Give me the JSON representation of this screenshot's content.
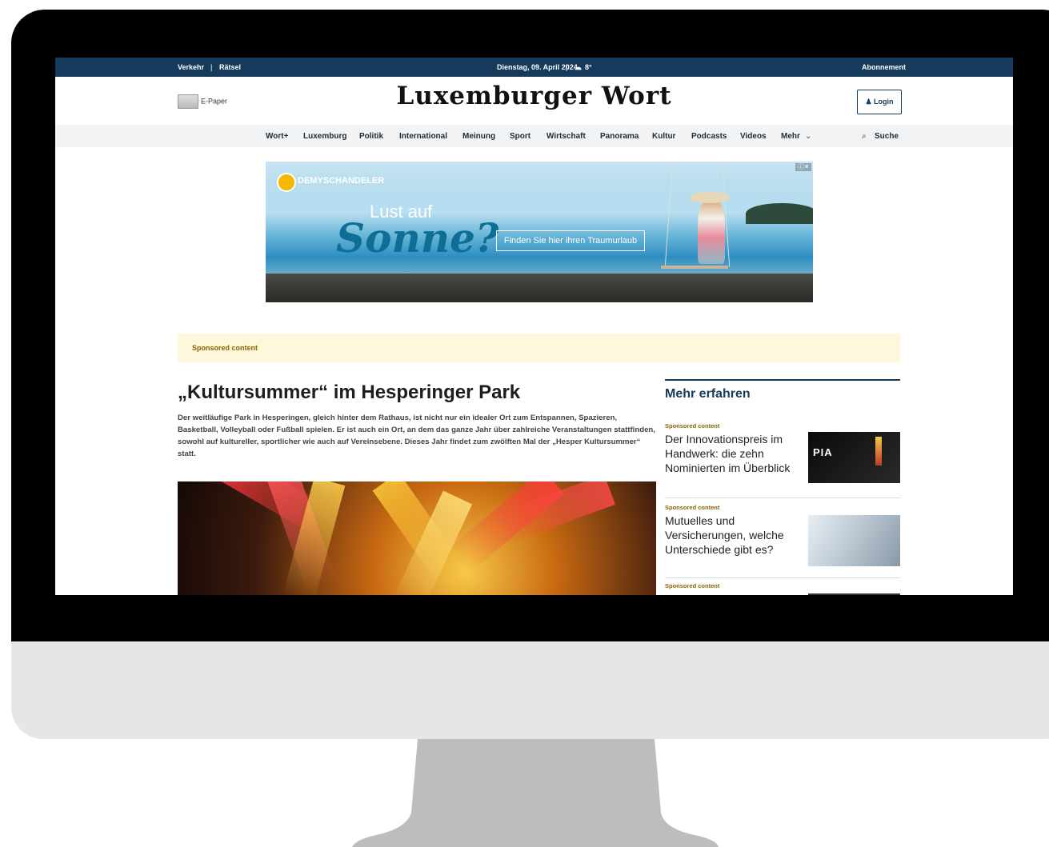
{
  "topbar": {
    "left_links": [
      "Verkehr",
      "Rätsel"
    ],
    "separator": "|",
    "date": "Dienstag, 09. April 2024",
    "weather": "8°",
    "right_link": "Abonnement"
  },
  "header": {
    "epaper": "E-Paper",
    "logo": "Luxemburger Wort",
    "login": "Login"
  },
  "nav": {
    "items": [
      "Wort+",
      "Luxemburg",
      "Politik",
      "International",
      "Meinung",
      "Sport",
      "Wirtschaft",
      "Panorama",
      "Kultur",
      "Podcasts",
      "Videos",
      "Mehr"
    ],
    "search": "Suche"
  },
  "ad": {
    "brand": "DEMYSCHANDELER",
    "line1": "Lust auf",
    "line2": "Sonne?",
    "cta": "Finden Sie hier ihren Traumurlaub",
    "close": "ⓘ✕"
  },
  "sponsored_bar": "Sponsored content",
  "article": {
    "headline": "„Kultursummer“ im Hesperinger Park",
    "lead": "Der weitläufige Park in Hesperingen, gleich hinter dem Rathaus, ist nicht nur ein idealer Ort zum Entspannen, Spazieren, Basketball, Volleyball oder Fußball spielen. Er ist auch ein Ort, an dem das ganze Jahr über zahlreiche Veranstaltungen stattfinden, sowohl auf kultureller, sportlicher wie auch auf Vereinsebene. Dieses Jahr findet zum zwölften Mal der „Hesper Kultursummer“ statt."
  },
  "sidebar": {
    "title": "Mehr erfahren",
    "cards": [
      {
        "tag": "Sponsored content",
        "title": "Der Innovationspreis im Handwerk: die zehn Nominierten im Überblick",
        "thumb_text": "PIA"
      },
      {
        "tag": "Sponsored content",
        "title": "Mutuelles und Versicherungen, welche Unterschiede gibt es?"
      },
      {
        "tag": "Sponsored content",
        "title": ""
      }
    ]
  },
  "colors": {
    "navy": "#153a5b",
    "sponsor_bg": "#fdf7dc",
    "sponsor_text": "#8a6400"
  }
}
